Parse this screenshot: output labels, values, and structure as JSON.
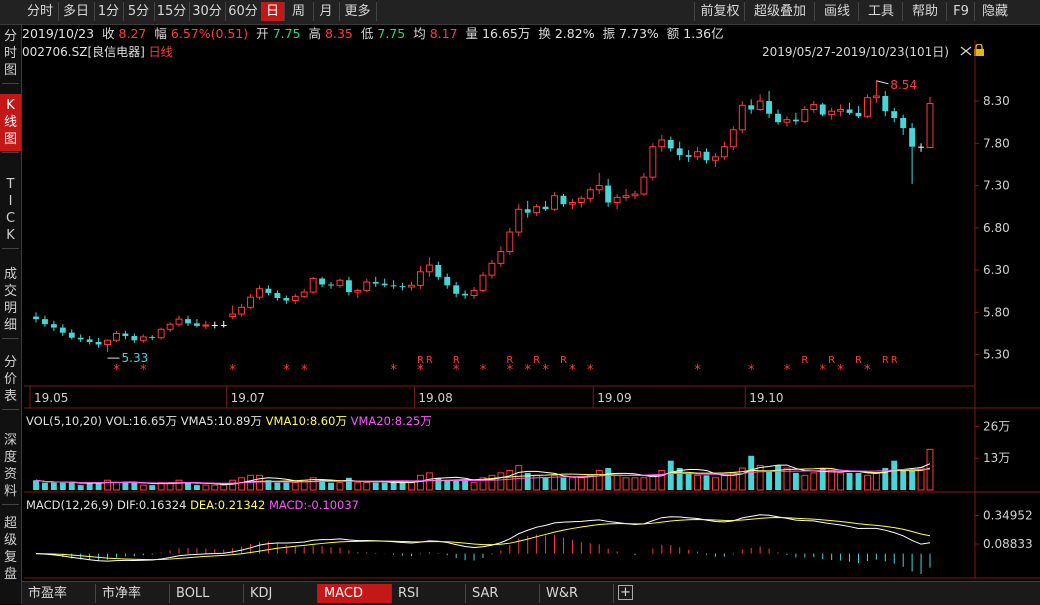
{
  "toolbar": {
    "left": [
      "分时",
      "多日",
      "1分",
      "5分",
      "15分",
      "30分",
      "60分",
      "日",
      "周",
      "月",
      "更多"
    ],
    "active": "日",
    "right": [
      "前复权",
      "超级叠加",
      "画线",
      "工具",
      "帮助",
      "F9",
      "隐藏"
    ]
  },
  "sidebar": [
    {
      "label": "分时图",
      "active": false
    },
    {
      "label": "K线图",
      "active": true
    },
    {
      "label": "TICK",
      "active": false
    },
    {
      "label": "成交明细",
      "active": false
    },
    {
      "label": "分价表",
      "active": false
    },
    {
      "label": "深度资料",
      "active": false
    },
    {
      "label": "超级复盘",
      "active": false
    }
  ],
  "quote": {
    "date": "2019/10/23",
    "close_label": "收",
    "close": "8.27",
    "change_label": "幅",
    "change": "6.57%(0.51)",
    "open_label": "开",
    "open": "7.75",
    "high_label": "高",
    "high": "8.35",
    "low_label": "低",
    "low": "7.75",
    "avg_label": "均",
    "avg": "8.17",
    "volume_label": "量",
    "volume": "16.65万",
    "turnover_label": "换",
    "turnover": "2.82%",
    "amplitude_label": "振",
    "amplitude": "7.73%",
    "amount_label": "额",
    "amount": "1.36亿"
  },
  "stock": {
    "code": "002706.SZ",
    "name": "[良信电器]",
    "period": "日线"
  },
  "range": "2019/05/27-2019/10/23(101日)",
  "main_chart": {
    "y_ticks": [
      "8.30",
      "7.80",
      "7.30",
      "6.80",
      "6.30",
      "5.80",
      "5.30"
    ],
    "x_ticks": [
      "19.05",
      "19.07",
      "19.08",
      "19.09",
      "19.10"
    ],
    "high_marker": "8.54",
    "low_marker": "5.33"
  },
  "vol_panel": {
    "title": "VOL(5,10,20)",
    "vol": "VOL:16.65万",
    "ma5": "VMA5:10.89万",
    "ma10": "VMA10:8.60万",
    "ma20": "VMA20:8.25万",
    "y_ticks": [
      "26万",
      "13万"
    ]
  },
  "macd_panel": {
    "title": "MACD(12,26,9)",
    "dif": "DIF:0.16324",
    "dea": "DEA:0.21342",
    "macd": "MACD:-0.10037",
    "y_ticks": [
      "0.34952",
      "0.08833"
    ]
  },
  "bottom_tabs": [
    "市盈率",
    "市净率",
    "BOLL",
    "KDJ",
    "MACD",
    "RSI",
    "SAR",
    "W&R"
  ],
  "bottom_active": "MACD",
  "colors": {
    "up": "#ff3b3b",
    "down": "#46d6d6",
    "flat": "#ffffff",
    "active": "#c41818",
    "ma5": "#ffffff",
    "ma10": "#ffff55",
    "ma20": "#ff55ff"
  },
  "chart_data": {
    "type": "candlestick",
    "period": "daily",
    "date_range": "2019/05/27-2019/10/23",
    "days": 101,
    "ohlc": [
      [
        5.75,
        5.8,
        5.68,
        5.72
      ],
      [
        5.72,
        5.76,
        5.63,
        5.66
      ],
      [
        5.66,
        5.7,
        5.58,
        5.62
      ],
      [
        5.62,
        5.66,
        5.52,
        5.56
      ],
      [
        5.56,
        5.6,
        5.48,
        5.5
      ],
      [
        5.5,
        5.54,
        5.45,
        5.48
      ],
      [
        5.48,
        5.52,
        5.42,
        5.45
      ],
      [
        5.45,
        5.5,
        5.38,
        5.42
      ],
      [
        5.42,
        5.48,
        5.33,
        5.47
      ],
      [
        5.47,
        5.58,
        5.45,
        5.55
      ],
      [
        5.55,
        5.58,
        5.48,
        5.52
      ],
      [
        5.52,
        5.55,
        5.44,
        5.47
      ],
      [
        5.47,
        5.54,
        5.44,
        5.51
      ],
      [
        5.51,
        5.53,
        5.47,
        5.5
      ],
      [
        5.5,
        5.62,
        5.48,
        5.6
      ],
      [
        5.6,
        5.68,
        5.57,
        5.66
      ],
      [
        5.66,
        5.76,
        5.63,
        5.72
      ],
      [
        5.72,
        5.76,
        5.64,
        5.67
      ],
      [
        5.67,
        5.72,
        5.62,
        5.64
      ],
      [
        5.64,
        5.7,
        5.6,
        5.65
      ],
      [
        5.65,
        5.69,
        5.61,
        5.65
      ],
      [
        5.65,
        5.7,
        5.62,
        5.65
      ],
      [
        5.75,
        5.88,
        5.72,
        5.78
      ],
      [
        5.78,
        5.9,
        5.75,
        5.86
      ],
      [
        5.86,
        6.02,
        5.84,
        5.98
      ],
      [
        5.98,
        6.12,
        5.95,
        6.08
      ],
      [
        6.08,
        6.12,
        6.0,
        6.03
      ],
      [
        6.03,
        6.06,
        5.94,
        5.97
      ],
      [
        5.97,
        6.0,
        5.9,
        5.94
      ],
      [
        5.94,
        6.02,
        5.9,
        5.99
      ],
      [
        5.99,
        6.08,
        5.97,
        6.04
      ],
      [
        6.04,
        6.22,
        6.02,
        6.2
      ],
      [
        6.2,
        6.22,
        6.1,
        6.13
      ],
      [
        6.13,
        6.16,
        6.08,
        6.12
      ],
      [
        6.12,
        6.2,
        6.09,
        6.18
      ],
      [
        6.18,
        6.22,
        6.0,
        6.04
      ],
      [
        6.04,
        6.08,
        5.97,
        6.06
      ],
      [
        6.06,
        6.2,
        6.04,
        6.16
      ],
      [
        6.16,
        6.22,
        6.1,
        6.14
      ],
      [
        6.14,
        6.2,
        6.1,
        6.12
      ],
      [
        6.12,
        6.18,
        6.08,
        6.11
      ],
      [
        6.11,
        6.15,
        6.06,
        6.1
      ],
      [
        6.1,
        6.16,
        6.06,
        6.12
      ],
      [
        6.12,
        6.35,
        6.08,
        6.28
      ],
      [
        6.28,
        6.45,
        6.22,
        6.36
      ],
      [
        6.36,
        6.4,
        6.18,
        6.22
      ],
      [
        6.22,
        6.26,
        6.08,
        6.12
      ],
      [
        6.12,
        6.16,
        5.98,
        6.02
      ],
      [
        6.02,
        6.06,
        5.96,
        6.0
      ],
      [
        6.0,
        6.1,
        5.96,
        6.06
      ],
      [
        6.06,
        6.28,
        6.04,
        6.24
      ],
      [
        6.24,
        6.42,
        6.2,
        6.38
      ],
      [
        6.38,
        6.58,
        6.34,
        6.52
      ],
      [
        6.52,
        6.8,
        6.48,
        6.75
      ],
      [
        6.75,
        7.08,
        6.7,
        7.02
      ],
      [
        7.02,
        7.12,
        6.92,
        6.98
      ],
      [
        6.98,
        7.08,
        6.94,
        7.05
      ],
      [
        7.05,
        7.12,
        7.0,
        7.02
      ],
      [
        7.02,
        7.22,
        7.0,
        7.18
      ],
      [
        7.18,
        7.2,
        7.05,
        7.08
      ],
      [
        7.08,
        7.14,
        7.02,
        7.1
      ],
      [
        7.1,
        7.18,
        7.04,
        7.15
      ],
      [
        7.15,
        7.28,
        7.1,
        7.25
      ],
      [
        7.25,
        7.45,
        7.2,
        7.3
      ],
      [
        7.3,
        7.38,
        7.05,
        7.1
      ],
      [
        7.1,
        7.2,
        7.02,
        7.16
      ],
      [
        7.16,
        7.26,
        7.12,
        7.18
      ],
      [
        7.18,
        7.24,
        7.14,
        7.2
      ],
      [
        7.2,
        7.45,
        7.18,
        7.4
      ],
      [
        7.4,
        7.8,
        7.36,
        7.76
      ],
      [
        7.76,
        7.9,
        7.7,
        7.84
      ],
      [
        7.84,
        7.88,
        7.7,
        7.74
      ],
      [
        7.74,
        7.82,
        7.6,
        7.66
      ],
      [
        7.66,
        7.72,
        7.58,
        7.64
      ],
      [
        7.64,
        7.76,
        7.6,
        7.7
      ],
      [
        7.7,
        7.74,
        7.56,
        7.6
      ],
      [
        7.6,
        7.68,
        7.52,
        7.64
      ],
      [
        7.64,
        7.82,
        7.6,
        7.76
      ],
      [
        7.76,
        8.0,
        7.72,
        7.96
      ],
      [
        7.96,
        8.3,
        7.92,
        8.25
      ],
      [
        8.25,
        8.32,
        8.15,
        8.2
      ],
      [
        8.2,
        8.38,
        8.18,
        8.3
      ],
      [
        8.3,
        8.42,
        8.1,
        8.15
      ],
      [
        8.15,
        8.2,
        8.02,
        8.05
      ],
      [
        8.05,
        8.12,
        8.0,
        8.08
      ],
      [
        8.08,
        8.16,
        8.02,
        8.06
      ],
      [
        8.06,
        8.24,
        8.04,
        8.2
      ],
      [
        8.2,
        8.3,
        8.16,
        8.26
      ],
      [
        8.26,
        8.28,
        8.12,
        8.14
      ],
      [
        8.14,
        8.22,
        8.08,
        8.18
      ],
      [
        8.18,
        8.26,
        8.12,
        8.2
      ],
      [
        8.2,
        8.28,
        8.14,
        8.16
      ],
      [
        8.16,
        8.24,
        8.1,
        8.12
      ],
      [
        8.12,
        8.38,
        8.1,
        8.34
      ],
      [
        8.34,
        8.54,
        8.28,
        8.36
      ],
      [
        8.36,
        8.42,
        8.12,
        8.18
      ],
      [
        8.18,
        8.22,
        8.05,
        8.1
      ],
      [
        8.1,
        8.14,
        7.9,
        7.98
      ],
      [
        7.98,
        8.04,
        7.32,
        7.76
      ],
      [
        7.76,
        7.8,
        7.7,
        7.76
      ],
      [
        7.75,
        8.35,
        7.75,
        8.27
      ]
    ],
    "volume": [
      4,
      3,
      3,
      3,
      3,
      2,
      3,
      3,
      4,
      3,
      3,
      3,
      2,
      2,
      3,
      3,
      4,
      3,
      2,
      2,
      2,
      2,
      4,
      5,
      6,
      6,
      4,
      3,
      3,
      3,
      4,
      5,
      4,
      3,
      3,
      5,
      3,
      3,
      3,
      3,
      3,
      3,
      3,
      6,
      7,
      5,
      4,
      4,
      4,
      3,
      5,
      6,
      7,
      8,
      10,
      7,
      6,
      5,
      6,
      5,
      5,
      5,
      6,
      8,
      9,
      6,
      5,
      5,
      5,
      6,
      8,
      12,
      9,
      7,
      6,
      6,
      5,
      6,
      7,
      9,
      14,
      10,
      8,
      10,
      9,
      7,
      6,
      7,
      9,
      8,
      7,
      7,
      7,
      6,
      7,
      9,
      12,
      8,
      8,
      9,
      16.65
    ],
    "vol_unit": "万"
  }
}
